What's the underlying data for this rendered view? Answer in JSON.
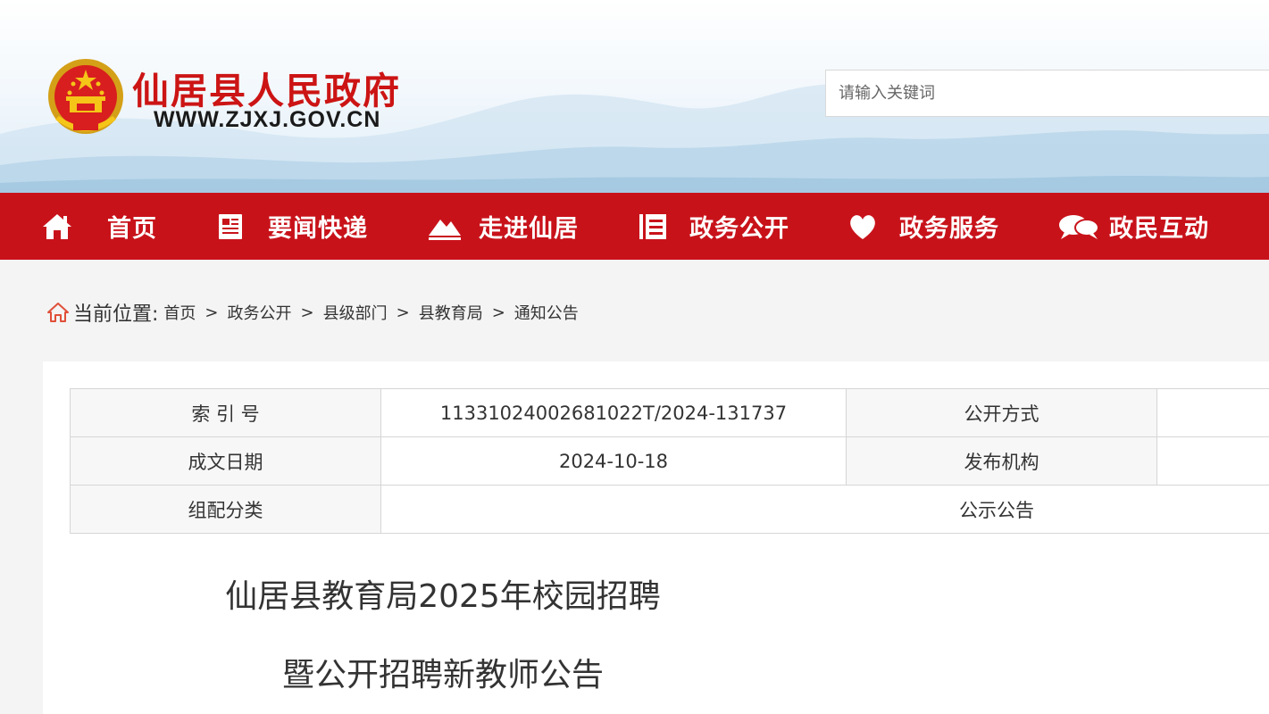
{
  "header": {
    "site_title": "仙居县人民政府",
    "site_url": "WWW.ZJXJ.GOV.CN",
    "search_placeholder": "请输入关键词"
  },
  "nav": {
    "items": [
      {
        "label": "首页",
        "icon": "home-icon"
      },
      {
        "label": "要闻快递",
        "icon": "newspaper-icon"
      },
      {
        "label": "走进仙居",
        "icon": "mountain-icon"
      },
      {
        "label": "政务公开",
        "icon": "list-icon"
      },
      {
        "label": "政务服务",
        "icon": "heart-icon"
      },
      {
        "label": "政民互动",
        "icon": "chat-icon"
      }
    ]
  },
  "breadcrumb": {
    "prefix": "当前位置:",
    "items": [
      "首页",
      "政务公开",
      "县级部门",
      "县教育局",
      "通知公告"
    ],
    "separator": ">"
  },
  "meta": {
    "index_label": "索 引 号",
    "index_value": "11331024002681022T/2024-131737",
    "open_mode_label": "公开方式",
    "open_mode_value": "",
    "date_label": "成文日期",
    "date_value": "2024-10-18",
    "publisher_label": "发布机构",
    "publisher_value": "",
    "category_label": "组配分类",
    "category_value": "公示公告"
  },
  "article": {
    "title_line1": "仙居县教育局2025年校园招聘",
    "title_line2": "暨公开招聘新教师公告"
  },
  "colors": {
    "brand_red": "#c8121a",
    "title_red": "#cc1414",
    "page_bg": "#f4f4f4"
  }
}
